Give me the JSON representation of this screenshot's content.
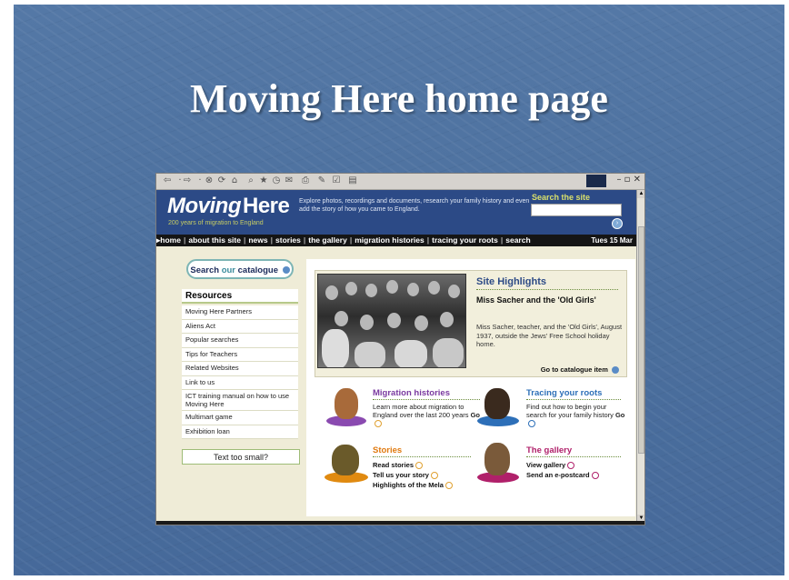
{
  "slide": {
    "title": "Moving Here home page"
  },
  "toolbar": {
    "icons": [
      "back-icon",
      "forward-icon",
      "stop-icon",
      "refresh-icon",
      "home-icon",
      "search-icon",
      "favorites-icon",
      "history-icon",
      "mail-icon",
      "print-icon",
      "edit-icon",
      "discuss-icon"
    ]
  },
  "header": {
    "logo_main": "Moving",
    "logo_here": "Here",
    "tagline": "200 years of migration to England",
    "intro": "Explore photos, recordings and documents, research your family history and even add the story of how you came to England.",
    "search_title": "Search the site",
    "search_value": ""
  },
  "nav": {
    "items": [
      "home",
      "about this site",
      "news",
      "stories",
      "the gallery",
      "migration histories",
      "tracing your roots",
      "search"
    ],
    "date": "Tues 15 Mar"
  },
  "sidebar": {
    "catalogue_prefix": "Search ",
    "catalogue_our": "our",
    "catalogue_suffix": " catalogue",
    "resources_title": "Resources",
    "resources": [
      "Moving Here Partners",
      "Aliens Act",
      "Popular searches",
      "Tips for Teachers",
      "Related Websites",
      "Link to us",
      "ICT training manual on how to use Moving Here",
      "Multimart game",
      "Exhibition loan"
    ],
    "text_small": "Text too small?"
  },
  "highlights": {
    "title": "Site Highlights",
    "subtitle": "Miss Sacher and the 'Old Girls'",
    "description": "Miss Sacher, teacher, and the 'Old Girls', August 1937, outside the Jews' Free School holiday home.",
    "link": "Go to catalogue item"
  },
  "features": {
    "migration": {
      "title": "Migration histories",
      "text": "Learn more about migration to England over the last 200 years",
      "go": "Go",
      "color": "#7a3aa0"
    },
    "roots": {
      "title": "Tracing your roots",
      "text": "Find out how to begin your search for your family history",
      "go": "Go",
      "color": "#2d6fb8"
    },
    "stories": {
      "title": "Stories",
      "links": [
        "Read stories",
        "Tell us your story",
        "Highlights of the Mela"
      ],
      "color": "#e07a10"
    },
    "gallery": {
      "title": "The gallery",
      "links": [
        "View gallery",
        "Send an e-postcard"
      ],
      "color": "#b0206a"
    }
  }
}
